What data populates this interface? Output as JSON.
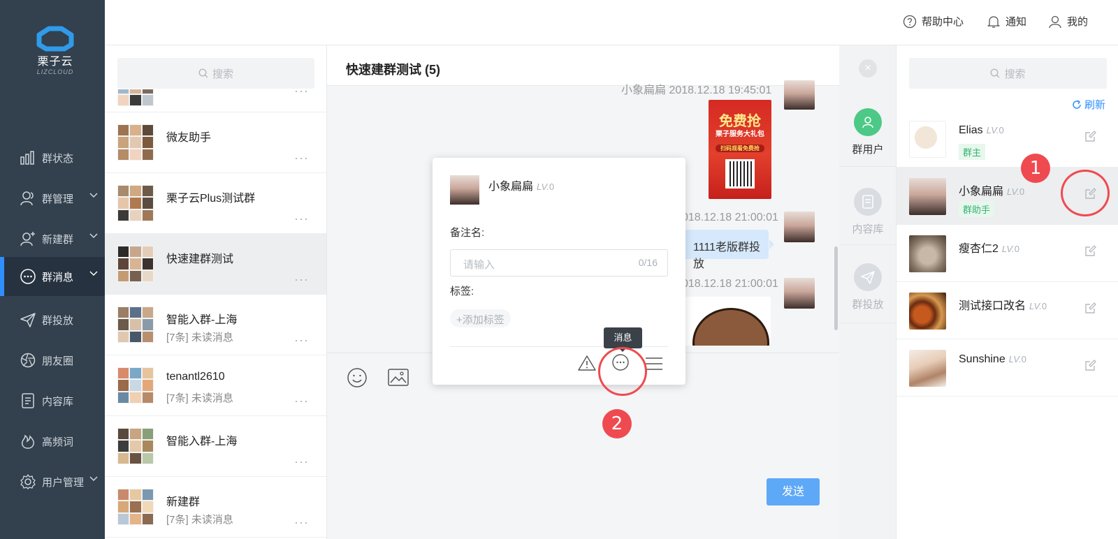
{
  "brand": {
    "name": "栗子云",
    "sub": "LIZCLOUD",
    "color": "#2f8fff"
  },
  "header": {
    "help": "帮助中心",
    "notify": "通知",
    "mine": "我的"
  },
  "nav": {
    "items": [
      {
        "label": "群状态",
        "icon": "bar-chart-icon"
      },
      {
        "label": "群管理",
        "icon": "user-group-icon"
      },
      {
        "label": "新建群",
        "icon": "add-user-icon"
      },
      {
        "label": "群消息",
        "icon": "chat-bubble-icon",
        "active": true
      },
      {
        "label": "群投放",
        "icon": "paper-plane-icon"
      },
      {
        "label": "朋友圈",
        "icon": "aperture-icon"
      },
      {
        "label": "内容库",
        "icon": "document-icon"
      },
      {
        "label": "高频词",
        "icon": "flame-icon"
      },
      {
        "label": "用户管理",
        "icon": "gear-icon"
      }
    ]
  },
  "group_list": {
    "search_placeholder": "搜索",
    "items": [
      {
        "name": "微友助手",
        "sub": ""
      },
      {
        "name": "栗子云Plus测试群",
        "sub": ""
      },
      {
        "name": "快速建群测试",
        "sub": "",
        "selected": true
      },
      {
        "name": "智能入群-上海",
        "sub": "[7条] 未读消息"
      },
      {
        "name": "tenantl2610",
        "sub": "[7条] 未读消息"
      },
      {
        "name": "智能入群-上海",
        "sub": ""
      },
      {
        "name": "新建群",
        "sub": "[7条] 未读消息"
      }
    ],
    "more": "···"
  },
  "chat": {
    "title": "快速建群测试 (5)",
    "messages": [
      {
        "meta": "小象扁扁   2018.12.18 19:45:01",
        "type": "image"
      },
      {
        "meta": "018.12.18 21:00:01",
        "type": "text",
        "text": "1111老版群投放"
      },
      {
        "meta": "018.12.18 21:00:01",
        "type": "sticker"
      }
    ],
    "poster": {
      "title": "免费抢",
      "subtitle": "栗子服务大礼包",
      "banner": "扫码观看免费抢"
    },
    "send_label": "发送"
  },
  "right_tabs": [
    {
      "label": "群用户",
      "icon": "group-user-icon",
      "active": true
    },
    {
      "label": "内容库",
      "icon": "document-icon"
    },
    {
      "label": "群投放",
      "icon": "paper-plane-icon"
    }
  ],
  "members": {
    "search_placeholder": "搜索",
    "refresh": "刷新",
    "lv_prefix": "LV.",
    "items": [
      {
        "name": "Elias",
        "lv": "0",
        "role": "群主"
      },
      {
        "name": "小象扁扁",
        "lv": "0",
        "role": "群助手",
        "selected": true
      },
      {
        "name": "瘦杏仁2",
        "lv": "0",
        "role": ""
      },
      {
        "name": "测试接口改名",
        "lv": "0",
        "role": ""
      },
      {
        "name": "Sunshine",
        "lv": "0",
        "role": ""
      }
    ]
  },
  "popup": {
    "name": "小象扁扁",
    "lv": "0",
    "remark_label": "备注名:",
    "remark_placeholder": "请输入",
    "remark_count": "0/16",
    "tag_label": "标签:",
    "add_tag": "+添加标签",
    "tooltip": "消息"
  },
  "annotations": {
    "one": "1",
    "two": "2",
    "color": "#ef4a4f"
  }
}
